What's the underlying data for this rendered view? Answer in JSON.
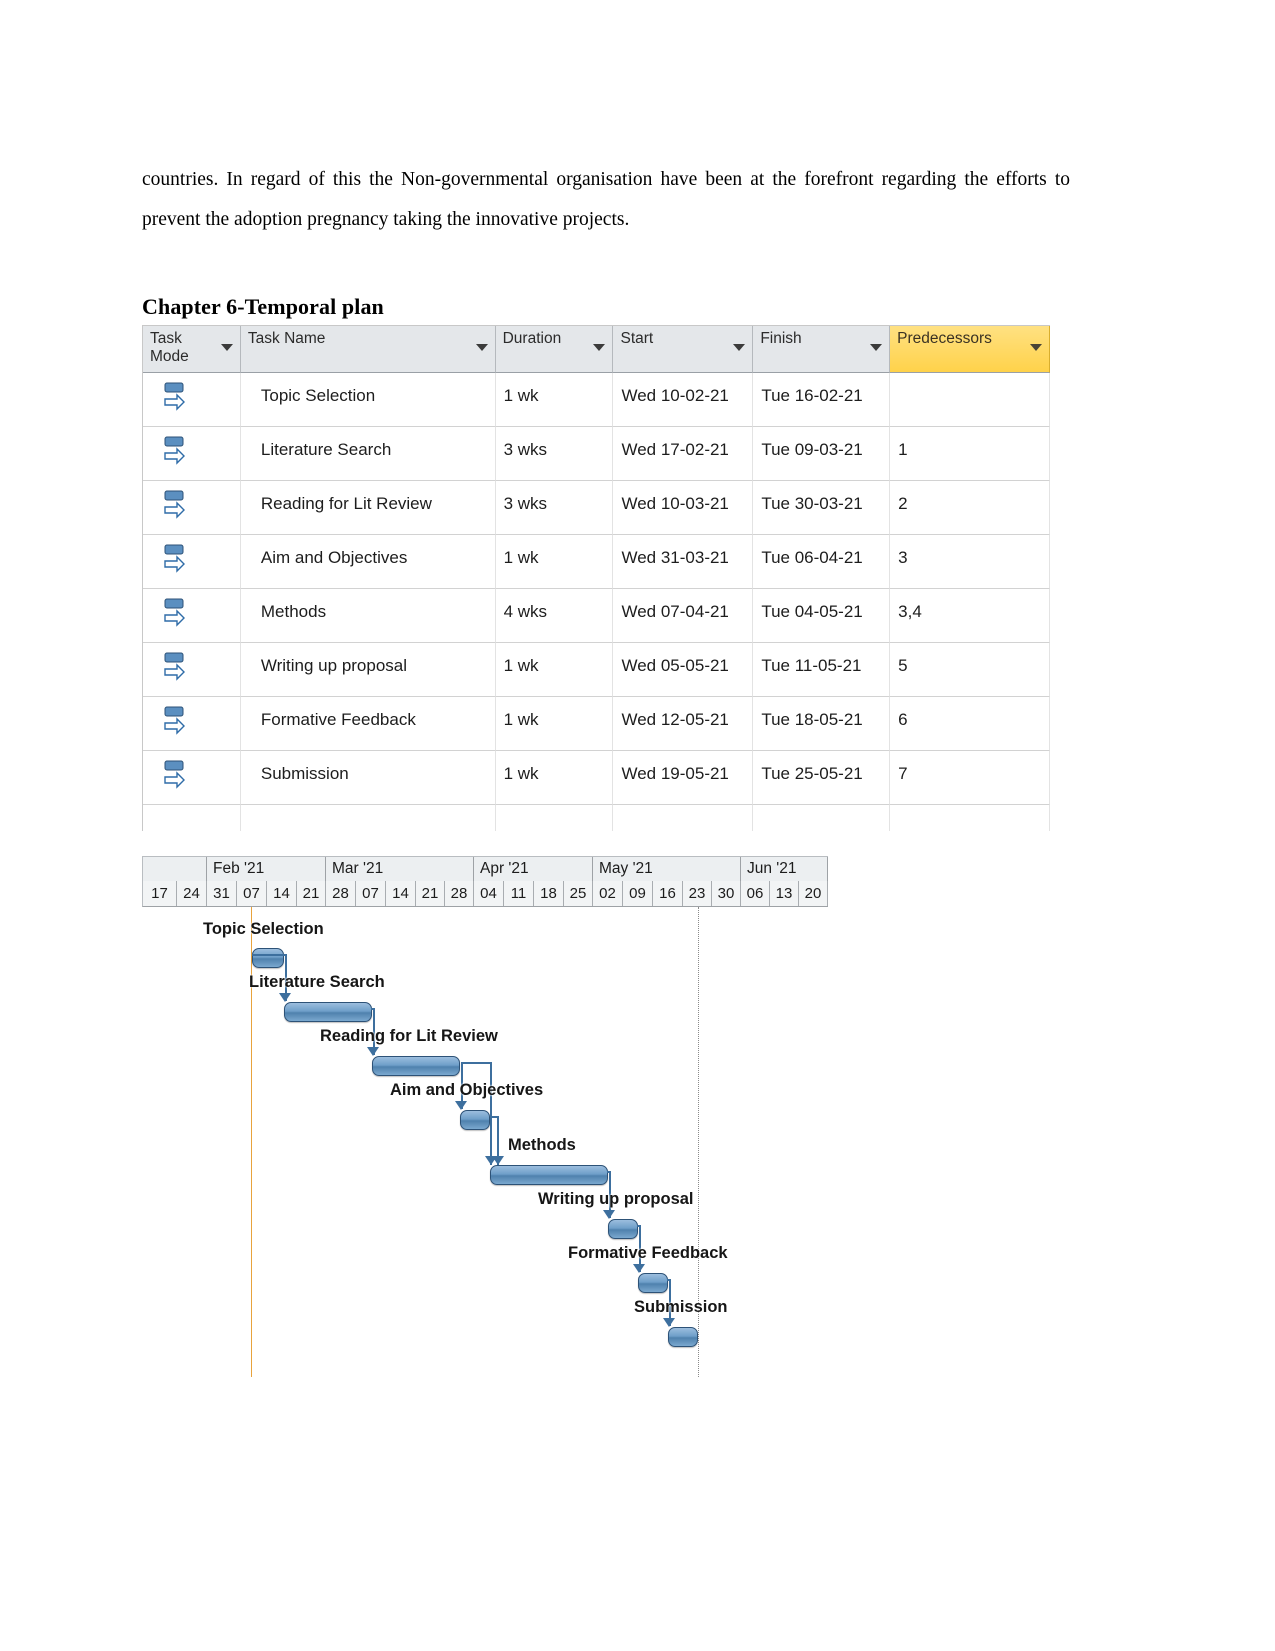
{
  "document": {
    "paragraph": "countries. In regard of this the Non-governmental organisation have been at the forefront regarding the efforts to prevent the adoption pregnancy taking the innovative projects.",
    "heading": "Chapter 6-Temporal plan"
  },
  "table": {
    "columns": [
      {
        "key": "mode",
        "label": "Task\nMode",
        "highlight": false,
        "filter": true
      },
      {
        "key": "name",
        "label": "Task Name",
        "highlight": false,
        "filter": true
      },
      {
        "key": "dur",
        "label": "Duration",
        "highlight": false,
        "filter": true
      },
      {
        "key": "start",
        "label": "Start",
        "highlight": false,
        "filter": true
      },
      {
        "key": "finish",
        "label": "Finish",
        "highlight": false,
        "filter": true
      },
      {
        "key": "pred",
        "label": "Predecessors",
        "highlight": true,
        "filter": true
      }
    ],
    "rows": [
      {
        "mode": "manually-scheduled-icon",
        "name": "Topic Selection",
        "dur": "1 wk",
        "start": "Wed 10-02-21",
        "finish": "Tue 16-02-21",
        "pred": ""
      },
      {
        "mode": "manually-scheduled-icon",
        "name": "Literature Search",
        "dur": "3 wks",
        "start": "Wed 17-02-21",
        "finish": "Tue 09-03-21",
        "pred": "1"
      },
      {
        "mode": "manually-scheduled-icon",
        "name": "Reading for Lit Review",
        "dur": "3 wks",
        "start": "Wed 10-03-21",
        "finish": "Tue 30-03-21",
        "pred": "2"
      },
      {
        "mode": "manually-scheduled-icon",
        "name": "Aim and Objectives",
        "dur": "1 wk",
        "start": "Wed 31-03-21",
        "finish": "Tue 06-04-21",
        "pred": "3"
      },
      {
        "mode": "manually-scheduled-icon",
        "name": "Methods",
        "dur": "4 wks",
        "start": "Wed 07-04-21",
        "finish": "Tue 04-05-21",
        "pred": "3,4"
      },
      {
        "mode": "manually-scheduled-icon",
        "name": "Writing up proposal",
        "dur": "1 wk",
        "start": "Wed 05-05-21",
        "finish": "Tue 11-05-21",
        "pred": "5"
      },
      {
        "mode": "manually-scheduled-icon",
        "name": "Formative Feedback",
        "dur": "1 wk",
        "start": "Wed 12-05-21",
        "finish": "Tue 18-05-21",
        "pred": "6"
      },
      {
        "mode": "manually-scheduled-icon",
        "name": "Submission",
        "dur": "1 wk",
        "start": "Wed 19-05-21",
        "finish": "Tue 25-05-21",
        "pred": "7"
      }
    ]
  },
  "chart_data": {
    "type": "bar",
    "title": "Gantt chart - Temporal plan",
    "orientation": "horizontal-timeline",
    "timeline": {
      "months": [
        {
          "label": "",
          "weeks": 2
        },
        {
          "label": "Feb '21",
          "weeks": 4
        },
        {
          "label": "Mar '21",
          "weeks": 5
        },
        {
          "label": "Apr '21",
          "weeks": 4
        },
        {
          "label": "May '21",
          "weeks": 5
        },
        {
          "label": "Jun '21",
          "weeks": 3
        }
      ],
      "weeks": [
        "17",
        "24",
        "31",
        "07",
        "14",
        "21",
        "28",
        "07",
        "14",
        "21",
        "28",
        "04",
        "11",
        "18",
        "25",
        "02",
        "09",
        "16",
        "23",
        "30",
        "06",
        "13",
        "20"
      ],
      "today_marker_week_index": 3,
      "status_marker_week_index": 19
    },
    "categories": [
      "Topic Selection",
      "Literature Search",
      "Reading for Lit Review",
      "Aim and Objectives",
      "Methods",
      "Writing up proposal",
      "Formative Feedback",
      "Submission"
    ],
    "bars": [
      {
        "name": "Topic Selection",
        "start": "Wed 10-02-21",
        "finish": "Tue 16-02-21",
        "duration_weeks": 1,
        "start_week_index": 3.45,
        "end_week_index": 4.45
      },
      {
        "name": "Literature Search",
        "start": "Wed 17-02-21",
        "finish": "Tue 09-03-21",
        "duration_weeks": 3,
        "start_week_index": 4.45,
        "end_week_index": 7.45
      },
      {
        "name": "Reading for Lit Review",
        "start": "Wed 10-03-21",
        "finish": "Tue 30-03-21",
        "duration_weeks": 3,
        "start_week_index": 7.45,
        "end_week_index": 10.45
      },
      {
        "name": "Aim and Objectives",
        "start": "Wed 31-03-21",
        "finish": "Tue 06-04-21",
        "duration_weeks": 1,
        "start_week_index": 10.45,
        "end_week_index": 11.45
      },
      {
        "name": "Methods",
        "start": "Wed 07-04-21",
        "finish": "Tue 04-05-21",
        "duration_weeks": 4,
        "start_week_index": 11.45,
        "end_week_index": 15.45
      },
      {
        "name": "Writing up proposal",
        "start": "Wed 05-05-21",
        "finish": "Tue 11-05-21",
        "duration_weeks": 1,
        "start_week_index": 15.45,
        "end_week_index": 16.45
      },
      {
        "name": "Formative Feedback",
        "start": "Wed 12-05-21",
        "finish": "Tue 18-05-21",
        "duration_weeks": 1,
        "start_week_index": 16.45,
        "end_week_index": 17.45
      },
      {
        "name": "Submission",
        "start": "Wed 19-05-21",
        "finish": "Tue 25-05-21",
        "duration_weeks": 1,
        "start_week_index": 17.45,
        "end_week_index": 18.45
      }
    ],
    "dependencies": [
      {
        "from": "Topic Selection",
        "to": "Literature Search",
        "type": "FS"
      },
      {
        "from": "Literature Search",
        "to": "Reading for Lit Review",
        "type": "FS"
      },
      {
        "from": "Reading for Lit Review",
        "to": "Aim and Objectives",
        "type": "FS"
      },
      {
        "from": "Reading for Lit Review",
        "to": "Methods",
        "type": "FS"
      },
      {
        "from": "Aim and Objectives",
        "to": "Methods",
        "type": "FS"
      },
      {
        "from": "Methods",
        "to": "Writing up proposal",
        "type": "FS"
      },
      {
        "from": "Writing up proposal",
        "to": "Formative Feedback",
        "type": "FS"
      },
      {
        "from": "Formative Feedback",
        "to": "Submission",
        "type": "FS"
      }
    ],
    "xlabel": "",
    "ylabel": "",
    "legend": []
  },
  "colors": {
    "bar_fill": "#6f9fc9",
    "bar_border": "#2d5277",
    "link": "#3d6f9e",
    "predecessor_header": "#ffd75e",
    "header_bg": "#e4e7ea",
    "today_line": "#e8a33d"
  }
}
